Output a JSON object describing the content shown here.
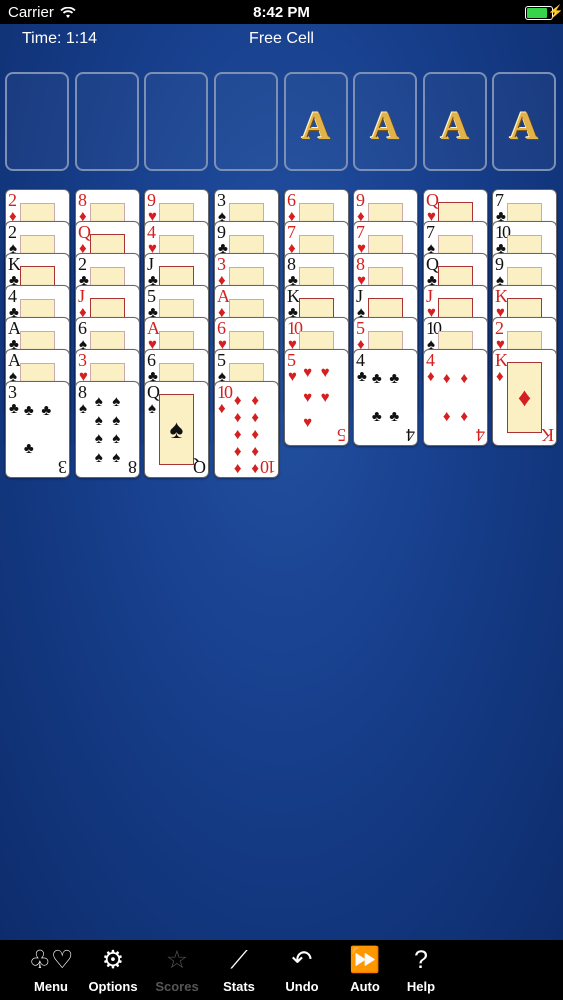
{
  "status_bar": {
    "carrier": "Carrier",
    "time": "8:42 PM"
  },
  "header": {
    "timer": "Time: 1:14",
    "title": "Free Cell"
  },
  "free_cells": [
    {},
    {},
    {},
    {}
  ],
  "foundations": [
    {
      "rank": "A"
    },
    {
      "rank": "A"
    },
    {
      "rank": "A"
    },
    {
      "rank": "A"
    }
  ],
  "colors": {
    "felt": "#173f8c",
    "red": "#d42020",
    "black": "#111111",
    "ace_gold": "#e3b349"
  },
  "columns": [
    {
      "cards": [
        {
          "rank": "2",
          "suit": "♦"
        },
        {
          "rank": "2",
          "suit": "♠"
        },
        {
          "rank": "K",
          "suit": "♣"
        },
        {
          "rank": "4",
          "suit": "♣"
        },
        {
          "rank": "A",
          "suit": "♣"
        },
        {
          "rank": "A",
          "suit": "♠"
        },
        {
          "rank": "3",
          "suit": "♣"
        }
      ]
    },
    {
      "cards": [
        {
          "rank": "8",
          "suit": "♦"
        },
        {
          "rank": "Q",
          "suit": "♦"
        },
        {
          "rank": "2",
          "suit": "♣"
        },
        {
          "rank": "J",
          "suit": "♦"
        },
        {
          "rank": "6",
          "suit": "♠"
        },
        {
          "rank": "3",
          "suit": "♥"
        },
        {
          "rank": "8",
          "suit": "♠"
        }
      ]
    },
    {
      "cards": [
        {
          "rank": "9",
          "suit": "♥"
        },
        {
          "rank": "4",
          "suit": "♥"
        },
        {
          "rank": "J",
          "suit": "♣"
        },
        {
          "rank": "5",
          "suit": "♣"
        },
        {
          "rank": "A",
          "suit": "♥"
        },
        {
          "rank": "6",
          "suit": "♣"
        },
        {
          "rank": "Q",
          "suit": "♠"
        }
      ]
    },
    {
      "cards": [
        {
          "rank": "3",
          "suit": "♠"
        },
        {
          "rank": "9",
          "suit": "♣"
        },
        {
          "rank": "3",
          "suit": "♦"
        },
        {
          "rank": "A",
          "suit": "♦"
        },
        {
          "rank": "6",
          "suit": "♥"
        },
        {
          "rank": "5",
          "suit": "♠"
        },
        {
          "rank": "10",
          "suit": "♦"
        }
      ]
    },
    {
      "cards": [
        {
          "rank": "6",
          "suit": "♦"
        },
        {
          "rank": "7",
          "suit": "♦"
        },
        {
          "rank": "8",
          "suit": "♣"
        },
        {
          "rank": "K",
          "suit": "♣"
        },
        {
          "rank": "10",
          "suit": "♥"
        },
        {
          "rank": "5",
          "suit": "♥"
        }
      ]
    },
    {
      "cards": [
        {
          "rank": "9",
          "suit": "♦"
        },
        {
          "rank": "7",
          "suit": "♥"
        },
        {
          "rank": "8",
          "suit": "♥"
        },
        {
          "rank": "J",
          "suit": "♠"
        },
        {
          "rank": "5",
          "suit": "♦"
        },
        {
          "rank": "4",
          "suit": "♣"
        }
      ]
    },
    {
      "cards": [
        {
          "rank": "Q",
          "suit": "♥"
        },
        {
          "rank": "7",
          "suit": "♠"
        },
        {
          "rank": "Q",
          "suit": "♣"
        },
        {
          "rank": "J",
          "suit": "♥"
        },
        {
          "rank": "10",
          "suit": "♠"
        },
        {
          "rank": "4",
          "suit": "♦"
        }
      ]
    },
    {
      "cards": [
        {
          "rank": "7",
          "suit": "♣"
        },
        {
          "rank": "10",
          "suit": "♣"
        },
        {
          "rank": "9",
          "suit": "♠"
        },
        {
          "rank": "K",
          "suit": "♥"
        },
        {
          "rank": "2",
          "suit": "♥"
        },
        {
          "rank": "K",
          "suit": "♦"
        }
      ]
    }
  ],
  "toolbar": [
    {
      "label": "Menu",
      "icon": "suits-icon",
      "glyph": "♧♡",
      "enabled": true
    },
    {
      "label": "Options",
      "icon": "gears-icon",
      "glyph": "⚙",
      "enabled": true
    },
    {
      "label": "Scores",
      "icon": "star-icon",
      "glyph": "☆",
      "enabled": false
    },
    {
      "label": "Stats",
      "icon": "chart-line-icon",
      "glyph": "⟋",
      "enabled": true
    },
    {
      "label": "Undo",
      "icon": "undo-icon",
      "glyph": "↶",
      "enabled": true
    },
    {
      "label": "Auto",
      "icon": "fast-forward-icon",
      "glyph": "⏩",
      "enabled": true
    },
    {
      "label": "Help",
      "icon": "question-icon",
      "glyph": "?",
      "enabled": true
    }
  ]
}
